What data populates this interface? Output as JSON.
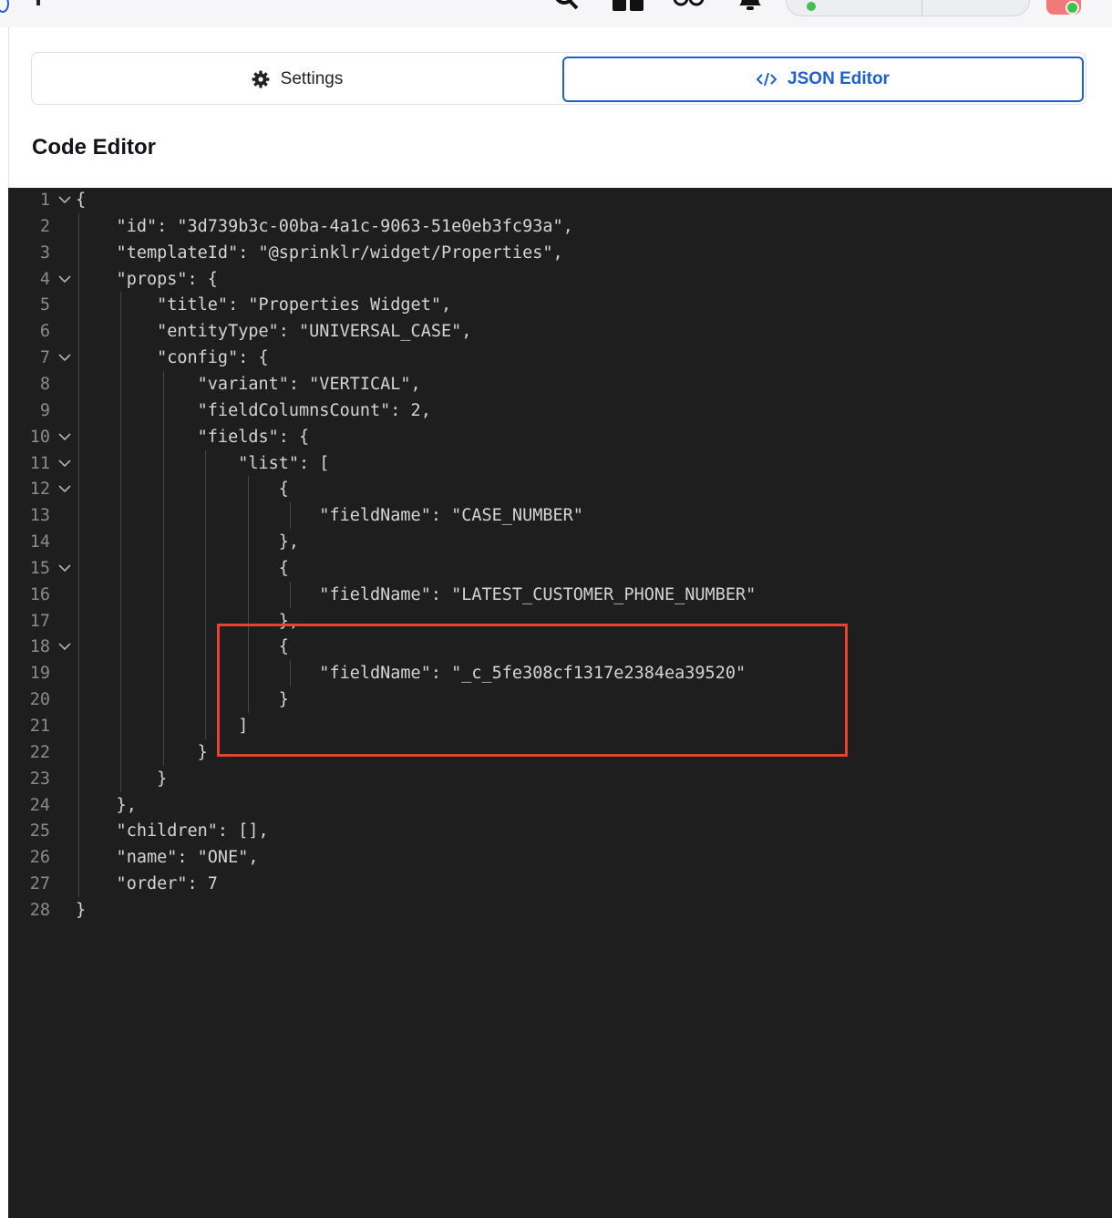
{
  "tabs": {
    "settings_label": "Settings",
    "settings_icon": "gear-icon",
    "json_label": "JSON Editor",
    "json_icon": "code-icon",
    "active": "json",
    "accent": "#1f5fd6"
  },
  "section_title": "Code Editor",
  "editor": {
    "lines": [
      "{",
      "    \"id\": \"3d739b3c-00ba-4a1c-9063-51e0eb3fc93a\",",
      "    \"templateId\": \"@sprinklr/widget/Properties\",",
      "    \"props\": {",
      "        \"title\": \"Properties Widget\",",
      "        \"entityType\": \"UNIVERSAL_CASE\",",
      "        \"config\": {",
      "            \"variant\": \"VERTICAL\",",
      "            \"fieldColumnsCount\": 2,",
      "            \"fields\": {",
      "                \"list\": [",
      "                    {",
      "                        \"fieldName\": \"CASE_NUMBER\"",
      "                    },",
      "                    {",
      "                        \"fieldName\": \"LATEST_CUSTOMER_PHONE_NUMBER\"",
      "                    },",
      "                    {",
      "                        \"fieldName\": \"_c_5fe308cf1317e2384ea39520\"",
      "                    }",
      "                ]",
      "            }",
      "        }",
      "    },",
      "    \"children\": [],",
      "    \"name\": \"ONE\",",
      "    \"order\": 7",
      "}"
    ],
    "foldable_lines": [
      1,
      4,
      7,
      10,
      11,
      12,
      15,
      18
    ],
    "annotation_color": "#e8432f"
  }
}
